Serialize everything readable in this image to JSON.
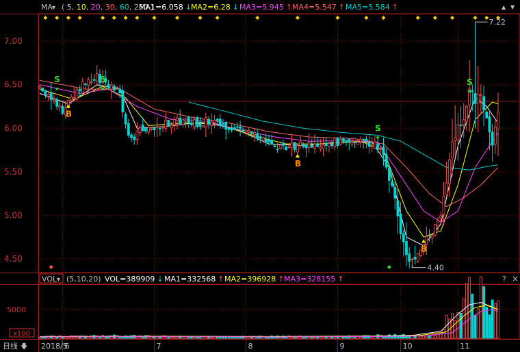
{
  "colors": {
    "bg": "#000000",
    "grid": "#7a0000",
    "frame": "#9b1a1a",
    "axis_text_price": "#c83232",
    "axis_text_vol": "#c83232",
    "up": "#ff5555",
    "down": "#00d4d4",
    "ma5": "#ffffff",
    "ma10": "#ffff00",
    "ma20": "#ff44ff",
    "ma30": "#ff6666",
    "ma60": "#00cccc",
    "signal_s": "#33dd33",
    "signal_b": "#ff8800",
    "diamond": "#ffcc00",
    "vol_ma1": "#ffffff",
    "vol_ma2": "#ffff00",
    "vol_ma3": "#ff44ff"
  },
  "main_header": {
    "indicator": "MA",
    "dropdown_arrow": "▾",
    "params_open": "(",
    "params": [
      "5",
      "10",
      "20",
      "30",
      "60",
      "250"
    ],
    "params_close": ")",
    "items": [
      {
        "label": "MA1=6.058",
        "arrow": "↓",
        "color": "#ffffff",
        "arrow_color": "#00d4d4"
      },
      {
        "label": "MA2=6.28",
        "arrow": "↓",
        "color": "#ffff00",
        "arrow_color": "#00d4d4"
      },
      {
        "label": "MA3=5.945",
        "arrow": "↑",
        "color": "#ff44ff",
        "arrow_color": "#ff5555"
      },
      {
        "label": "MA4=5.547",
        "arrow": "↑",
        "color": "#ff6666",
        "arrow_color": "#ff5555"
      },
      {
        "label": "MA5=5.584",
        "arrow": "↑",
        "color": "#00cccc",
        "arrow_color": "#ff5555"
      }
    ],
    "params_colors": [
      "#c0c0c0",
      "#ffff00",
      "#ff44ff",
      "#ff6666",
      "#00cccc",
      "#c0c0c0"
    ]
  },
  "vol_header": {
    "indicator": "VOL",
    "dropdown_arrow": "▾",
    "params": "(5,10,20)",
    "items": [
      {
        "label": "VOL=389909",
        "arrow": "↓",
        "color": "#ffffff",
        "arrow_color": "#00d4d4"
      },
      {
        "label": "MA1=332568",
        "arrow": "↑",
        "color": "#ffffff",
        "arrow_color": "#ff5555"
      },
      {
        "label": "MA2=396928",
        "arrow": "↑",
        "color": "#ffff00",
        "arrow_color": "#ff5555"
      },
      {
        "label": "MA3=328155",
        "arrow": "↑",
        "color": "#ff44ff",
        "arrow_color": "#ff5555"
      }
    ]
  },
  "window_controls": {
    "up": "▲",
    "down": "▼",
    "settings": "?",
    "close": "×"
  },
  "price_axis": {
    "ticks": [
      "7.00",
      "6.50",
      "6.00",
      "5.50",
      "5.00",
      "4.50"
    ]
  },
  "vol_axis": {
    "ticks": [
      "5000"
    ],
    "unit_label": "x100"
  },
  "period_selector": {
    "label": "日线",
    "arrow": "🡇"
  },
  "date_axis": {
    "labels": [
      "2018/5",
      "6",
      "7",
      "8",
      "9",
      "10",
      "11"
    ]
  },
  "annotations": {
    "high": "7.22",
    "low": "4.40",
    "s": "S",
    "b": "B"
  },
  "chart_data": [
    {
      "type": "candlestick",
      "title": "",
      "ylim": [
        4.35,
        7.3
      ],
      "y_ticks": [
        7.0,
        6.5,
        6.0,
        5.5,
        5.0,
        4.5
      ],
      "x_labels": [
        "2018/5",
        "6",
        "7",
        "8",
        "9",
        "10",
        "11"
      ],
      "grid": true,
      "series_names": [
        "MA1",
        "MA2",
        "MA3",
        "MA4",
        "MA5"
      ],
      "close_path": [
        [
          0,
          6.45
        ],
        [
          4,
          6.35
        ],
        [
          8,
          6.22
        ],
        [
          12,
          6.38
        ],
        [
          16,
          6.55
        ],
        [
          20,
          6.58
        ],
        [
          24,
          6.5
        ],
        [
          28,
          6.4
        ],
        [
          30,
          6.05
        ],
        [
          32,
          5.85
        ],
        [
          34,
          5.95
        ],
        [
          38,
          6.0
        ],
        [
          42,
          6.02
        ],
        [
          46,
          6.08
        ],
        [
          50,
          6.1
        ],
        [
          54,
          6.06
        ],
        [
          58,
          6.08
        ],
        [
          62,
          6.05
        ],
        [
          66,
          6.03
        ],
        [
          70,
          5.98
        ],
        [
          74,
          5.92
        ],
        [
          78,
          5.85
        ],
        [
          82,
          5.78
        ],
        [
          86,
          5.78
        ],
        [
          90,
          5.8
        ],
        [
          94,
          5.82
        ],
        [
          98,
          5.83
        ],
        [
          102,
          5.85
        ],
        [
          106,
          5.84
        ],
        [
          110,
          5.86
        ],
        [
          114,
          5.85
        ],
        [
          118,
          5.8
        ],
        [
          120,
          5.65
        ],
        [
          122,
          5.45
        ],
        [
          124,
          5.15
        ],
        [
          126,
          4.8
        ],
        [
          128,
          4.55
        ],
        [
          130,
          4.48
        ],
        [
          132,
          4.6
        ],
        [
          134,
          4.7
        ],
        [
          136,
          4.75
        ],
        [
          138,
          4.85
        ],
        [
          140,
          4.95
        ],
        [
          142,
          5.4
        ],
        [
          144,
          5.8
        ],
        [
          146,
          6.0
        ],
        [
          148,
          6.1
        ],
        [
          150,
          6.5
        ],
        [
          152,
          6.3
        ],
        [
          154,
          6.4
        ],
        [
          156,
          6.1
        ],
        [
          158,
          5.85
        ],
        [
          160,
          6.2
        ]
      ],
      "ma_paths": {
        "MA1": [
          [
            0,
            6.4
          ],
          [
            10,
            6.28
          ],
          [
            20,
            6.5
          ],
          [
            28,
            6.45
          ],
          [
            34,
            6.0
          ],
          [
            44,
            6.02
          ],
          [
            56,
            6.07
          ],
          [
            68,
            6.0
          ],
          [
            80,
            5.82
          ],
          [
            92,
            5.8
          ],
          [
            104,
            5.84
          ],
          [
            116,
            5.84
          ],
          [
            122,
            5.55
          ],
          [
            128,
            4.75
          ],
          [
            134,
            4.65
          ],
          [
            140,
            4.9
          ],
          [
            146,
            5.8
          ],
          [
            152,
            6.35
          ],
          [
            156,
            6.25
          ],
          [
            160,
            6.06
          ]
        ],
        "MA2": [
          [
            0,
            6.45
          ],
          [
            12,
            6.33
          ],
          [
            22,
            6.48
          ],
          [
            30,
            6.35
          ],
          [
            38,
            6.03
          ],
          [
            50,
            6.06
          ],
          [
            62,
            6.05
          ],
          [
            74,
            5.92
          ],
          [
            86,
            5.82
          ],
          [
            98,
            5.82
          ],
          [
            112,
            5.85
          ],
          [
            120,
            5.75
          ],
          [
            128,
            5.05
          ],
          [
            134,
            4.75
          ],
          [
            140,
            4.82
          ],
          [
            146,
            5.35
          ],
          [
            152,
            6.1
          ],
          [
            158,
            6.3
          ],
          [
            160,
            6.28
          ]
        ],
        "MA3": [
          [
            0,
            6.5
          ],
          [
            14,
            6.4
          ],
          [
            24,
            6.45
          ],
          [
            34,
            6.25
          ],
          [
            46,
            6.1
          ],
          [
            58,
            6.08
          ],
          [
            70,
            5.98
          ],
          [
            82,
            5.9
          ],
          [
            94,
            5.85
          ],
          [
            108,
            5.86
          ],
          [
            118,
            5.84
          ],
          [
            126,
            5.45
          ],
          [
            134,
            5.05
          ],
          [
            140,
            4.92
          ],
          [
            146,
            5.05
          ],
          [
            152,
            5.55
          ],
          [
            158,
            5.85
          ],
          [
            160,
            5.95
          ]
        ],
        "MA4": [
          [
            0,
            6.55
          ],
          [
            16,
            6.45
          ],
          [
            28,
            6.45
          ],
          [
            40,
            6.22
          ],
          [
            54,
            6.12
          ],
          [
            66,
            6.06
          ],
          [
            80,
            5.96
          ],
          [
            94,
            5.9
          ],
          [
            110,
            5.88
          ],
          [
            120,
            5.82
          ],
          [
            128,
            5.55
          ],
          [
            136,
            5.25
          ],
          [
            142,
            5.1
          ],
          [
            148,
            5.2
          ],
          [
            154,
            5.35
          ],
          [
            160,
            5.55
          ]
        ],
        "MA5": [
          [
            52,
            6.3
          ],
          [
            64,
            6.2
          ],
          [
            78,
            6.08
          ],
          [
            92,
            6.0
          ],
          [
            106,
            5.95
          ],
          [
            118,
            5.92
          ],
          [
            126,
            5.85
          ],
          [
            134,
            5.7
          ],
          [
            142,
            5.55
          ],
          [
            150,
            5.52
          ],
          [
            156,
            5.56
          ],
          [
            160,
            5.58
          ]
        ]
      },
      "high": 7.22,
      "low": 4.4,
      "signals": [
        {
          "type": "S",
          "x": 6,
          "price": 6.48
        },
        {
          "type": "B",
          "x": 10,
          "price": 6.25
        },
        {
          "type": "S",
          "x": 22,
          "price": 6.48
        },
        {
          "type": "B",
          "x": 90,
          "price": 5.68
        },
        {
          "type": "S",
          "x": 118,
          "price": 5.92
        },
        {
          "type": "B",
          "x": 134,
          "price": 4.7
        },
        {
          "type": "S",
          "x": 150,
          "price": 6.45
        }
      ]
    },
    {
      "type": "bar",
      "title": "",
      "series_names": [
        "VOL",
        "MA1",
        "MA2",
        "MA3"
      ],
      "y_ticks": [
        5000
      ],
      "ylim": [
        0,
        9000
      ],
      "volume_profile": [
        [
          0,
          300
        ],
        [
          20,
          400
        ],
        [
          30,
          450
        ],
        [
          40,
          350
        ],
        [
          60,
          250
        ],
        [
          80,
          300
        ],
        [
          100,
          280
        ],
        [
          115,
          350
        ],
        [
          120,
          600
        ],
        [
          128,
          500
        ],
        [
          134,
          400
        ],
        [
          138,
          500
        ],
        [
          140,
          900
        ],
        [
          142,
          3500
        ],
        [
          144,
          5500
        ],
        [
          146,
          4000
        ],
        [
          148,
          6500
        ],
        [
          150,
          7500
        ],
        [
          152,
          5000
        ],
        [
          154,
          8500
        ],
        [
          156,
          4500
        ],
        [
          158,
          5000
        ],
        [
          160,
          5200
        ]
      ],
      "vol_ma_profile": [
        [
          0,
          300
        ],
        [
          40,
          350
        ],
        [
          80,
          300
        ],
        [
          118,
          400
        ],
        [
          130,
          500
        ],
        [
          140,
          1200
        ],
        [
          146,
          4200
        ],
        [
          150,
          5800
        ],
        [
          154,
          6200
        ],
        [
          160,
          5000
        ]
      ]
    }
  ]
}
